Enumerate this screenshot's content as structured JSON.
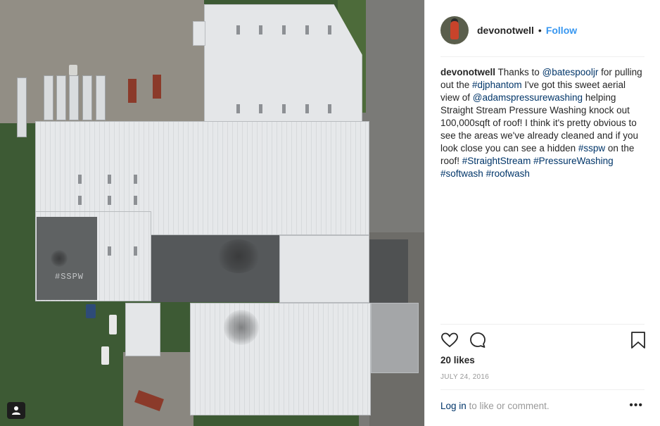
{
  "post": {
    "username": "devonotwell",
    "dot": "•",
    "follow_label": "Follow",
    "caption": {
      "author": "devonotwell",
      "t1": " Thanks to ",
      "m1": "@batespooljr",
      "t2": " for pulling out the ",
      "h1": "#djphantom",
      "t3": " I've got this sweet aerial view of ",
      "m2": "@adamspressurewashing",
      "t4": " helping Straight Stream Pressure Washing knock out 100,000sqft of roof! I think it's pretty obvious to see the areas we've already cleaned and if you look close you can see a hidden ",
      "h2": "#sspw",
      "t5": " on the roof! ",
      "h3": "#StraightStream",
      "t6": " ",
      "h4": "#PressureWashing",
      "t7": " ",
      "h5": "#softwash",
      "t8": " ",
      "h6": "#roofwash"
    },
    "likes": "20 likes",
    "date": "JULY 24, 2016",
    "login_link": "Log in",
    "login_rest": " to like or comment.",
    "more_label": "•••"
  },
  "photo": {
    "roof_text": "#SSPW",
    "icons": {
      "user": "user-icon",
      "like": "heart-icon",
      "comment": "comment-icon",
      "save": "bookmark-icon",
      "more": "more-options-icon"
    }
  },
  "colors": {
    "link": "#003569",
    "follow": "#3897f0",
    "text": "#262626",
    "muted": "#999999"
  }
}
